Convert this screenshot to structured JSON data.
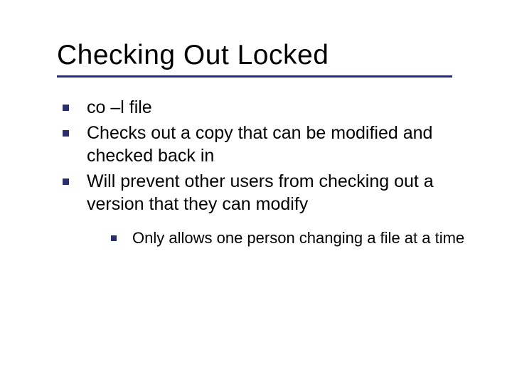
{
  "title": "Checking Out Locked",
  "bullets": [
    {
      "text": "co –l file"
    },
    {
      "text": "Checks out a copy that can be modified and checked back in"
    },
    {
      "text": "Will prevent other users from checking out a version that they can modify"
    }
  ],
  "sub_bullets": [
    {
      "text": "Only allows one person changing a file at a time"
    }
  ]
}
